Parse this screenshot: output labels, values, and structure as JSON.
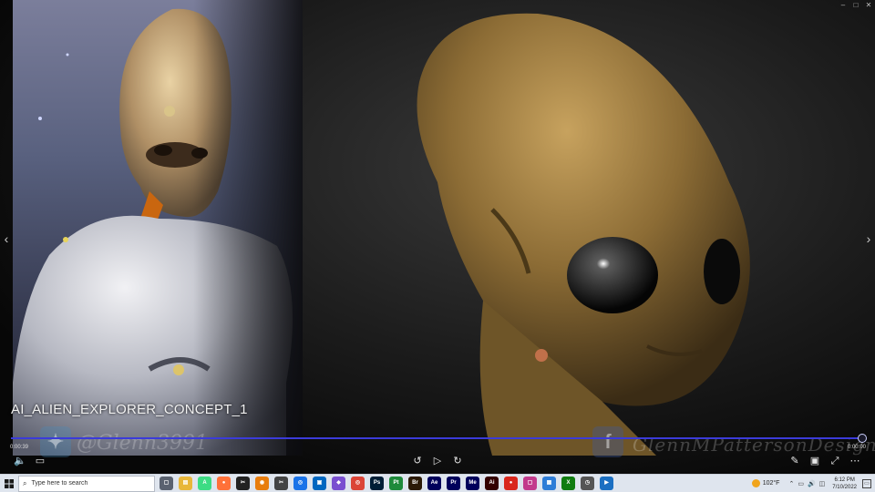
{
  "window": {
    "minimize": "–",
    "maximize": "□",
    "close": "✕"
  },
  "viewer": {
    "file_name": "AI_ALIEN_EXPLORER_CONCEPT_1",
    "watermark_left": "@Glenn3991",
    "watermark_right": "GlennMPattersonDesign",
    "prev_arrow": "‹",
    "next_arrow": "›"
  },
  "player": {
    "time_elapsed": "0:00:39",
    "time_remaining": "0:00:00",
    "progress": 1.0,
    "volume_icon": "speaker-icon",
    "captions_icon": "captions-icon"
  },
  "taskbar": {
    "search_placeholder": "Type here to search",
    "apps": [
      {
        "name": "task-view",
        "label": "▢",
        "color": "#5a6270"
      },
      {
        "name": "file-explorer",
        "label": "▤",
        "color": "#e8b73a"
      },
      {
        "name": "android-studio",
        "label": "A",
        "color": "#3ddc84"
      },
      {
        "name": "firefox",
        "label": "●",
        "color": "#ff7139"
      },
      {
        "name": "capcut",
        "label": "✂",
        "color": "#222222"
      },
      {
        "name": "blender",
        "label": "◉",
        "color": "#e87d0d"
      },
      {
        "name": "chrome-cut",
        "label": "✂",
        "color": "#444444"
      },
      {
        "name": "chrome",
        "label": "◎",
        "color": "#1a73e8"
      },
      {
        "name": "store",
        "label": "▣",
        "color": "#0067c0"
      },
      {
        "name": "vs",
        "label": "◆",
        "color": "#7a4fd0"
      },
      {
        "name": "chrome2",
        "label": "◎",
        "color": "#db4437"
      },
      {
        "name": "photoshop",
        "label": "Ps",
        "color": "#001e36"
      },
      {
        "name": "pixelmator",
        "label": "Pt",
        "color": "#1e8a3b"
      },
      {
        "name": "bridge",
        "label": "Br",
        "color": "#2b1a07"
      },
      {
        "name": "after-effects",
        "label": "Ae",
        "color": "#00005b"
      },
      {
        "name": "premiere",
        "label": "Pr",
        "color": "#00005b"
      },
      {
        "name": "media-encoder",
        "label": "Me",
        "color": "#00005b"
      },
      {
        "name": "illustrator",
        "label": "Ai",
        "color": "#330000"
      },
      {
        "name": "record",
        "label": "●",
        "color": "#d9271d"
      },
      {
        "name": "snip",
        "label": "▢",
        "color": "#c23a8c"
      },
      {
        "name": "photos",
        "label": "▦",
        "color": "#2e7dd7"
      },
      {
        "name": "xbox",
        "label": "X",
        "color": "#107c10"
      },
      {
        "name": "clock-app",
        "label": "◷",
        "color": "#555555"
      },
      {
        "name": "media-player",
        "label": "▶",
        "color": "#1b6fc2"
      }
    ],
    "weather": "102°F",
    "time": "6:12 PM",
    "date": "7/10/2022"
  }
}
